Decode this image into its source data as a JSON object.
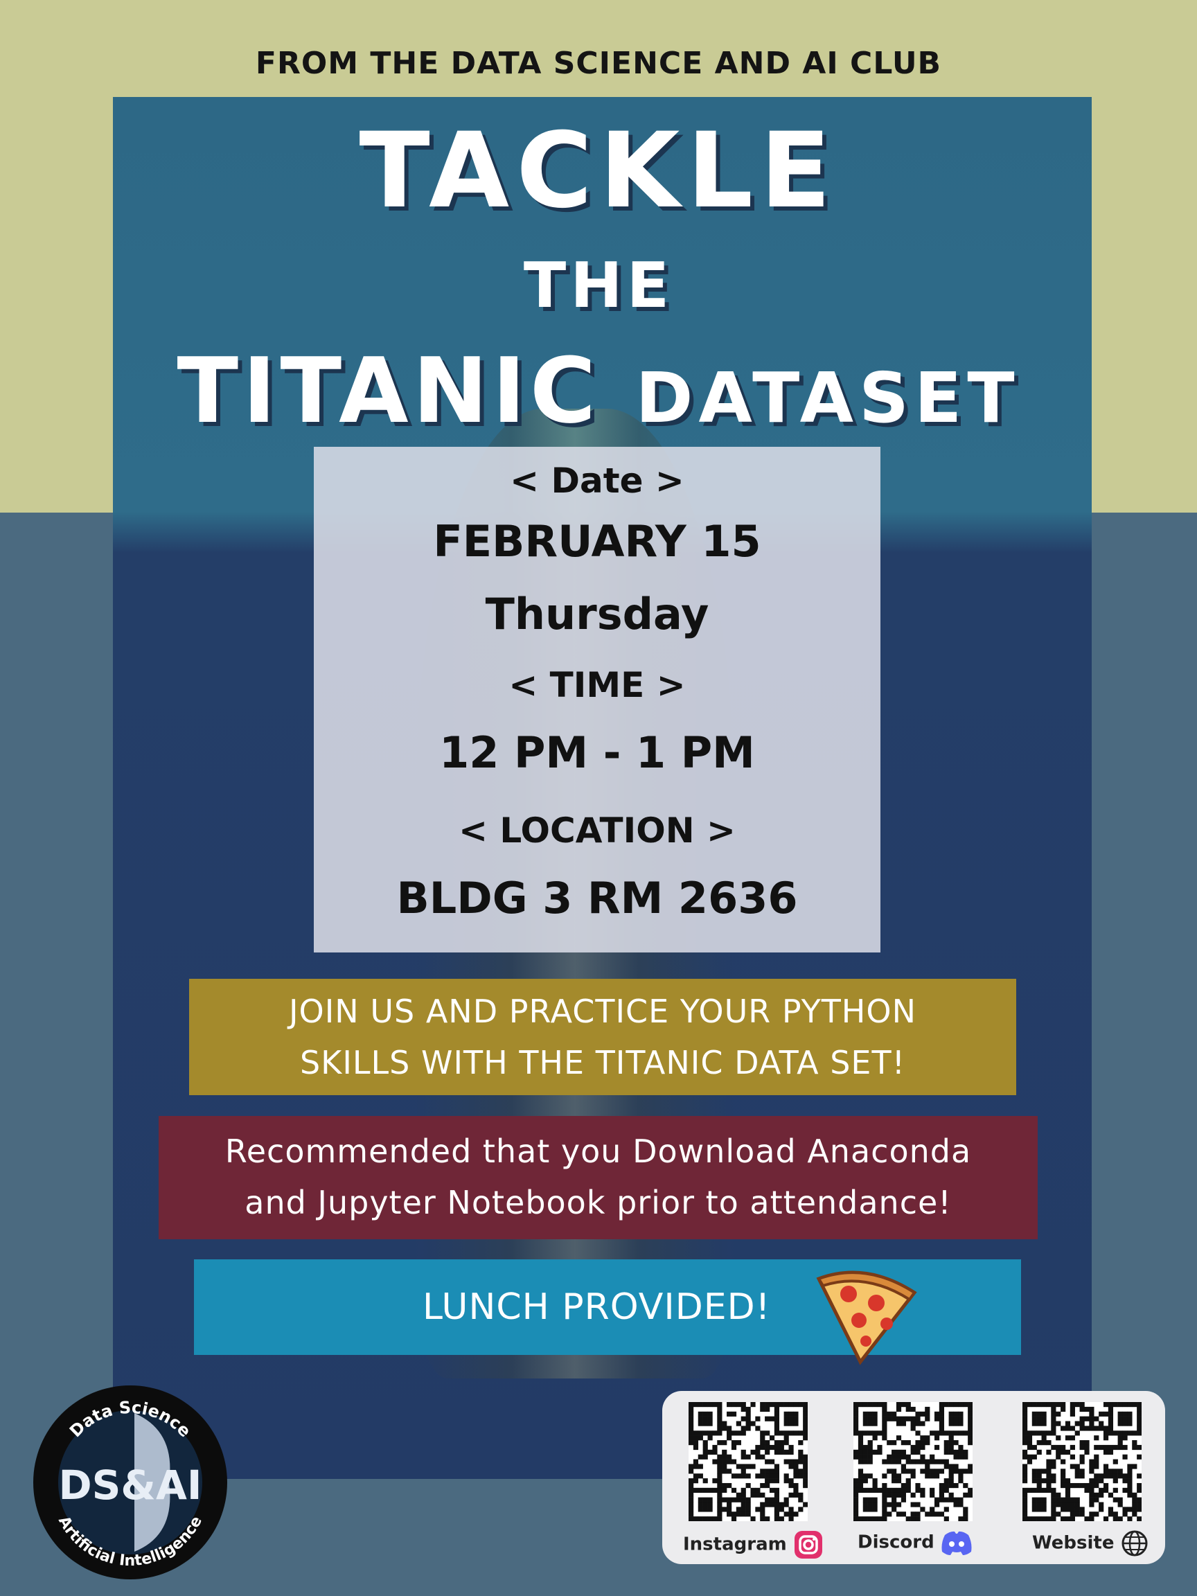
{
  "header": {
    "kicker": "FROM THE DATA SCIENCE AND AI CLUB"
  },
  "title": {
    "line1": "TACKLE",
    "line2": "THE",
    "line3_big": "TITANIC",
    "line3_small": "DATASET"
  },
  "event": {
    "date_label": "< Date >",
    "date_value": "FEBRUARY  15",
    "weekday": "Thursday",
    "time_label": "< TIME >",
    "time_value": "12 PM - 1 PM",
    "location_label": "< LOCATION >",
    "location_value": "BLDG 3 RM 2636"
  },
  "callouts": {
    "join_line1": "JOIN US AND PRACTICE YOUR PYTHON",
    "join_line2": "SKILLS WITH THE TITANIC DATA SET!",
    "recommend_line1": "Recommended that you Download Anaconda",
    "recommend_line2": "and Jupyter Notebook prior to attendance!",
    "lunch": "LUNCH PROVIDED!"
  },
  "logo": {
    "top_text": "Data Science",
    "bottom_text": "Artificial Intelligence",
    "mark": "DS&AI"
  },
  "links": [
    {
      "label": "Instagram",
      "icon": "instagram-icon"
    },
    {
      "label": "Discord",
      "icon": "discord-icon"
    },
    {
      "label": "Website",
      "icon": "globe-icon"
    }
  ],
  "colors": {
    "top_background": "#c9cb95",
    "join_band": "#a48a2c",
    "recommend_band": "#6f2637",
    "lunch_band": "#1b8db5"
  }
}
